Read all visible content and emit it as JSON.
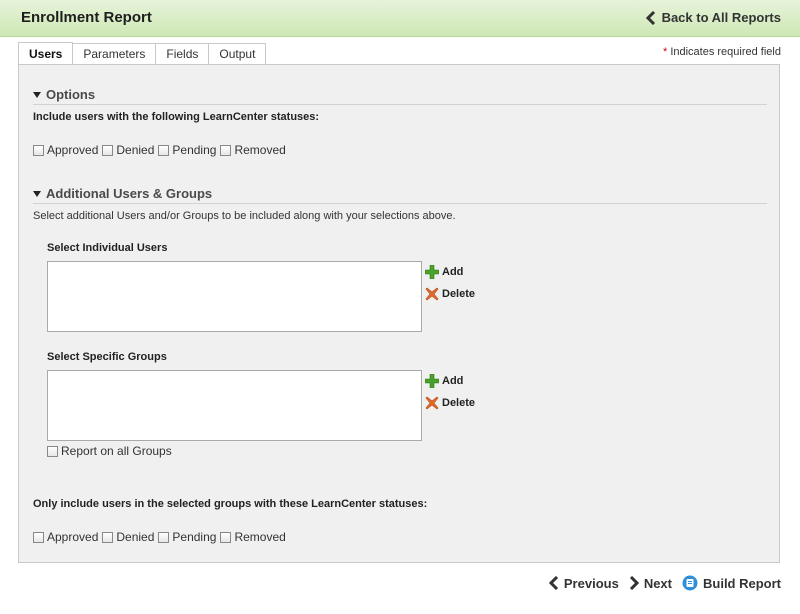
{
  "header": {
    "title": "Enrollment Report",
    "back_label": "Back to All Reports"
  },
  "tabs": [
    {
      "label": "Users",
      "active": true
    },
    {
      "label": "Parameters",
      "active": false
    },
    {
      "label": "Fields",
      "active": false
    },
    {
      "label": "Output",
      "active": false
    }
  ],
  "required_note": {
    "star": "*",
    "text": "Indicates required field"
  },
  "options": {
    "title": "Options",
    "statuses_label": "Include users with the following LearnCenter statuses:",
    "statuses": [
      "Approved",
      "Denied",
      "Pending",
      "Removed"
    ]
  },
  "additional": {
    "title": "Additional Users & Groups",
    "description": "Select additional Users and/or Groups to be included along with your selections above.",
    "users_label": "Select Individual Users",
    "groups_label": "Select Specific Groups",
    "add_label": "Add",
    "delete_label": "Delete",
    "all_groups_label": "Report on all Groups",
    "group_statuses_label": "Only include users in the selected groups with these LearnCenter statuses:",
    "group_statuses": [
      "Approved",
      "Denied",
      "Pending",
      "Removed"
    ]
  },
  "footer": {
    "previous_label": "Previous",
    "next_label": "Next",
    "build_label": "Build Report"
  },
  "colors": {
    "header_bg": "#cfe8b6",
    "panel_bg": "#f0f0f0",
    "add_icon": "#4aa02c",
    "delete_icon": "#e26a2c",
    "build_icon": "#2f8fd8",
    "required_star": "#dd0000"
  }
}
